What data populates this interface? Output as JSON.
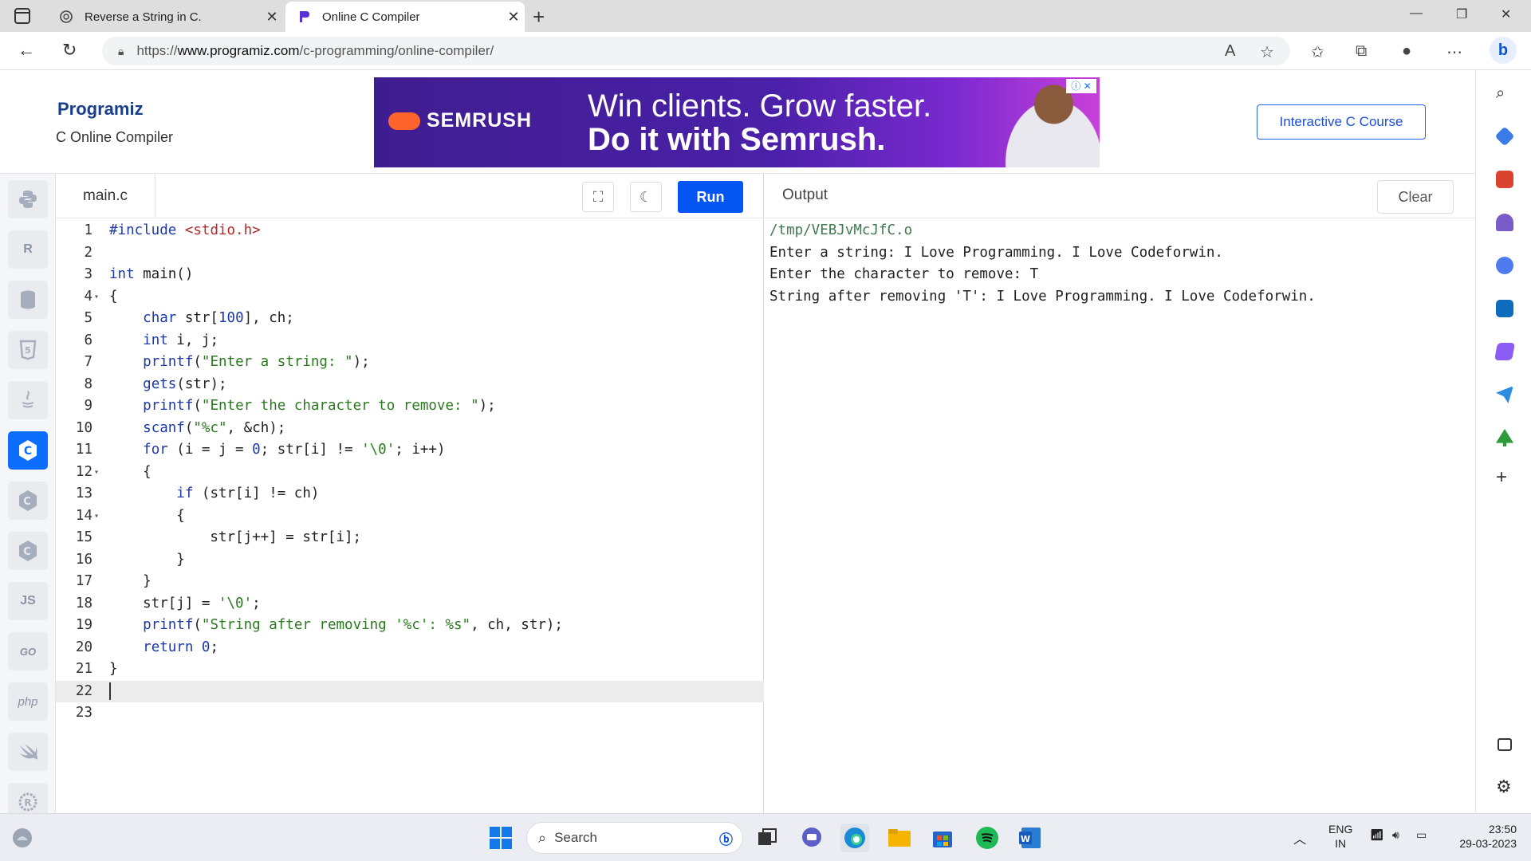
{
  "browser": {
    "tabs": [
      {
        "title": "Reverse a String in C.",
        "active": false
      },
      {
        "title": "Online C Compiler",
        "active": true
      }
    ],
    "url_prefix": "https://",
    "url_domain": "www.programiz.com",
    "url_path": "/c-programming/online-compiler/"
  },
  "header": {
    "logo": "Programiz",
    "subtitle": "C Online Compiler",
    "course_button": "Interactive C Course",
    "ad": {
      "brand": "SEMRUSH",
      "line1": "Win clients. Grow faster.",
      "line2": "Do it with Semrush."
    }
  },
  "languages": [
    {
      "name": "python-icon",
      "label": "",
      "active": false
    },
    {
      "name": "r-icon",
      "label": "R",
      "active": false
    },
    {
      "name": "sql-icon",
      "label": "",
      "active": false
    },
    {
      "name": "html-icon",
      "label": "5",
      "active": false
    },
    {
      "name": "java-icon",
      "label": "",
      "active": false
    },
    {
      "name": "c-icon",
      "label": "C",
      "active": true
    },
    {
      "name": "cpp-icon",
      "label": "C",
      "active": false
    },
    {
      "name": "csharp-icon",
      "label": "C",
      "active": false
    },
    {
      "name": "js-icon",
      "label": "JS",
      "active": false
    },
    {
      "name": "go-icon",
      "label": "GO",
      "active": false
    },
    {
      "name": "php-icon",
      "label": "php",
      "active": false
    },
    {
      "name": "swift-icon",
      "label": "",
      "active": false
    },
    {
      "name": "rust-icon",
      "label": "R",
      "active": false
    }
  ],
  "editor": {
    "filename": "main.c",
    "run_label": "Run",
    "lines": [
      {
        "n": "1",
        "fold": "",
        "html": "<span class=\"kw\">#include</span> <span class=\"inc\">&lt;stdio.h&gt;</span>"
      },
      {
        "n": "2",
        "fold": "",
        "html": ""
      },
      {
        "n": "3",
        "fold": "",
        "html": "<span class=\"kw\">int</span> main()"
      },
      {
        "n": "4",
        "fold": "▾",
        "html": "{"
      },
      {
        "n": "5",
        "fold": "",
        "html": "    <span class=\"kw\">char</span> str[<span class=\"num\">100</span>], ch;"
      },
      {
        "n": "6",
        "fold": "",
        "html": "    <span class=\"kw\">int</span> i, j;"
      },
      {
        "n": "7",
        "fold": "",
        "html": "    <span class=\"kw\">printf</span>(<span class=\"str\">\"Enter a string: \"</span>);"
      },
      {
        "n": "8",
        "fold": "",
        "html": "    <span class=\"kw\">gets</span>(str);"
      },
      {
        "n": "9",
        "fold": "",
        "html": "    <span class=\"kw\">printf</span>(<span class=\"str\">\"Enter the character to remove: \"</span>);"
      },
      {
        "n": "10",
        "fold": "",
        "html": "    <span class=\"kw\">scanf</span>(<span class=\"str\">\"%c\"</span>, &amp;ch);"
      },
      {
        "n": "11",
        "fold": "",
        "html": "    <span class=\"kw\">for</span> (i = j = <span class=\"num\">0</span>; str[i] != <span class=\"str\">'\\0'</span>; i++)"
      },
      {
        "n": "12",
        "fold": "▾",
        "html": "    {"
      },
      {
        "n": "13",
        "fold": "",
        "html": "        <span class=\"kw\">if</span> (str[i] != ch)"
      },
      {
        "n": "14",
        "fold": "▾",
        "html": "        {"
      },
      {
        "n": "15",
        "fold": "",
        "html": "            str[j++] = str[i];"
      },
      {
        "n": "16",
        "fold": "",
        "html": "        }"
      },
      {
        "n": "17",
        "fold": "",
        "html": "    }"
      },
      {
        "n": "18",
        "fold": "",
        "html": "    str[j] = <span class=\"str\">'\\0'</span>;"
      },
      {
        "n": "19",
        "fold": "",
        "html": "    <span class=\"kw\">printf</span>(<span class=\"str\">\"String after removing '%c': %s\"</span>, ch, str);"
      },
      {
        "n": "20",
        "fold": "",
        "html": "    <span class=\"kw\">return</span> <span class=\"num\">0</span>;"
      },
      {
        "n": "21",
        "fold": "",
        "html": "}"
      },
      {
        "n": "22",
        "fold": "",
        "html": "",
        "current": true
      },
      {
        "n": "23",
        "fold": "",
        "html": ""
      }
    ]
  },
  "output": {
    "title": "Output",
    "clear_label": "Clear",
    "lines": [
      "/tmp/VEBJvMcJfC.o",
      "Enter a string: I Love Programming. I Love Codeforwin.",
      "Enter the character to remove: T",
      "String after removing 'T': I Love Programming. I Love Codeforwin."
    ]
  },
  "taskbar": {
    "search_placeholder": "Search",
    "lang_top": "ENG",
    "lang_bottom": "IN",
    "time": "23:50",
    "date": "29-03-2023"
  }
}
